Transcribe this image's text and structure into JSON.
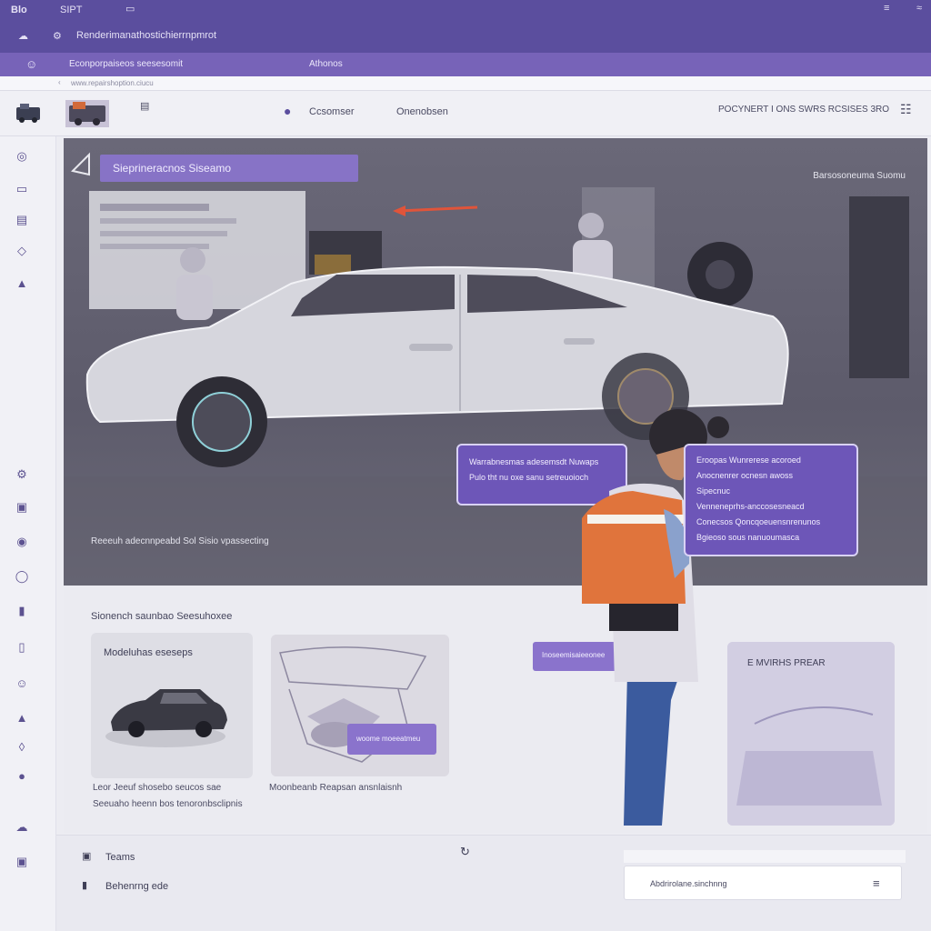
{
  "topbar": {
    "logo_text": "Blo",
    "menu_item": "SIPT",
    "page_title": "Renderimanathostichierrnpmrot"
  },
  "subbar": {
    "left_text": "Econporpaiseos seesesomit",
    "mid_text": "Athonos"
  },
  "url": {
    "text": "www.repairshoption.ciucu"
  },
  "header": {
    "nav_item_1": "Ccsomser",
    "nav_item_2": "Onenobsen",
    "right_text": "POCYNERT I ONS SWRS RCSISES 3RO"
  },
  "hero": {
    "title": "Sieprineracnos Siseamo",
    "subtitle": "Barsosoneuma Suomu",
    "caption": "Reeeuh adecnnpeabd Sol Sisio vpassecting",
    "callout_left": {
      "line1": "Warrabnesmas adesemsdt Nuwaps",
      "line2": "Pulo tht nu oxe sanu setreuoioch"
    },
    "callout_right": {
      "line1": "Eroopas Wunrerese acoroed",
      "line2": "Anocnenrer ocnesn awoss",
      "line3": "Sipecnuc",
      "line4": "Venneneprhs-anccosesneacd",
      "line5": "Conecsos Qoncqoeuensnrenunos",
      "line6": "Bgieoso sous nanuoumasca"
    }
  },
  "section": {
    "title": "Sionench saunbao Seesuhoxee"
  },
  "cards": [
    {
      "label": "Modeluhas eseseps",
      "caption_line1": "Leor Jeeuf shosebo seucos sae",
      "caption_line2": "Seeuaho heenn bos tenoronbsclipnis"
    },
    {
      "button_text": "woome moeeatmeu",
      "caption_line1": "Moonbeanb Reapsan ansnlaisnh"
    }
  ],
  "floating_button": {
    "text": "Inoseemisaieeonee"
  },
  "right_card": {
    "label": "E MVIRHS PREAR"
  },
  "footer": {
    "item_1": "Teams",
    "item_2": "Behenrng ede",
    "search_text": "Abdrirolane.sinchnng"
  },
  "colors": {
    "brand": "#5b4e9e",
    "accent": "#8773c6",
    "vest": "#e0743c"
  },
  "icons": [
    "home-icon",
    "wrench-icon",
    "car-icon",
    "gear-icon",
    "cloud-icon",
    "user-icon",
    "chart-icon",
    "menu-icon"
  ]
}
